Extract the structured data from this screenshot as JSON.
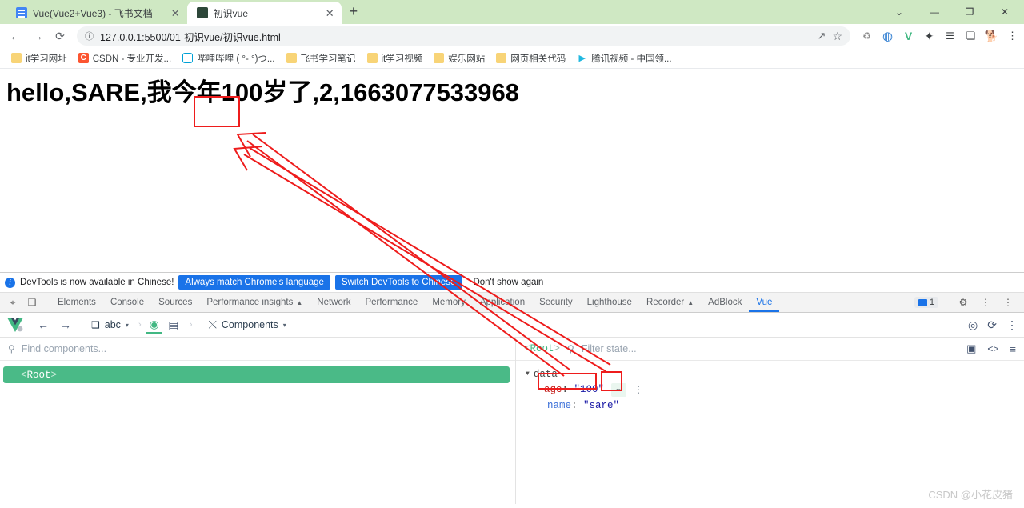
{
  "browser": {
    "tabs": [
      {
        "title": "Vue(Vue2+Vue3) - 飞书文档",
        "favicon": "document-icon",
        "active": false,
        "close_label": "✕"
      },
      {
        "title": "初识vue",
        "favicon": "dark-page-icon",
        "active": true,
        "close_label": "✕"
      }
    ],
    "new_tab_label": "+",
    "window_controls": {
      "expand": "⌄",
      "minimize": "—",
      "maximize": "❐",
      "close": "✕"
    },
    "nav": {
      "back": "←",
      "forward": "→",
      "reload": "⟳"
    },
    "omnibox": {
      "info_icon": "ⓘ",
      "url": "127.0.0.1:5500/01-初识vue/初识vue.html",
      "share_icon": "↗",
      "star_icon": "☆"
    },
    "extensions": [
      {
        "name": "recycle-extension-icon",
        "glyph": "♻"
      },
      {
        "name": "browser-extension-icon",
        "glyph": "◍"
      },
      {
        "name": "vue-devtools-extension-icon",
        "glyph": "V"
      },
      {
        "name": "extensions-puzzle-icon",
        "glyph": "✦"
      },
      {
        "name": "playlist-extension-icon",
        "glyph": "☰"
      },
      {
        "name": "side-panel-icon",
        "glyph": "❏"
      },
      {
        "name": "profile-avatar",
        "glyph": "🐕"
      },
      {
        "name": "chrome-menu-icon",
        "glyph": "⋮"
      }
    ],
    "bookmarks": [
      {
        "label": "it学习网址",
        "icon": "folder-icon"
      },
      {
        "label": "CSDN - 专业开发...",
        "icon": "csdn-icon"
      },
      {
        "label": "哔哩哔哩 ( °- °)つ...",
        "icon": "bilibili-icon"
      },
      {
        "label": "飞书学习笔记",
        "icon": "folder-icon"
      },
      {
        "label": "it学习视频",
        "icon": "folder-icon"
      },
      {
        "label": "娱乐网站",
        "icon": "folder-icon"
      },
      {
        "label": "网页相关代码",
        "icon": "folder-icon"
      },
      {
        "label": "腾讯视频 - 中国领...",
        "icon": "tencent-video-icon"
      }
    ]
  },
  "page": {
    "heading": "hello,SARE,我今年100岁了,2,1663077533968"
  },
  "devtools": {
    "notice": {
      "text": "DevTools is now available in Chinese!",
      "primary_button": "Always match Chrome's language",
      "secondary_button": "Switch DevTools to Chinese",
      "dismiss_button": "Don't show again"
    },
    "inspect_icon": "⌖",
    "device_icon": "❑",
    "tabs": [
      {
        "label": "Elements",
        "active": false
      },
      {
        "label": "Console",
        "active": false
      },
      {
        "label": "Sources",
        "active": false
      },
      {
        "label": "Performance insights",
        "active": false,
        "badge": "▲"
      },
      {
        "label": "Network",
        "active": false
      },
      {
        "label": "Performance",
        "active": false
      },
      {
        "label": "Memory",
        "active": false
      },
      {
        "label": "Application",
        "active": false
      },
      {
        "label": "Security",
        "active": false
      },
      {
        "label": "Lighthouse",
        "active": false
      },
      {
        "label": "Recorder",
        "active": false,
        "badge": "▲"
      },
      {
        "label": "AdBlock",
        "active": false
      },
      {
        "label": "Vue",
        "active": true
      }
    ],
    "message_count": "1",
    "settings_icon": "⚙",
    "more_icon": "⋮",
    "close_icon": "⋮"
  },
  "vue_panel": {
    "toolbar": {
      "logo": "vue-logo",
      "back": "←",
      "forward": "→",
      "app_selector": {
        "icon": "❑",
        "label": "abc",
        "caret": "▾"
      },
      "separator": "›",
      "active_icon": "◉",
      "grid_icon": "▤",
      "separator2": "›",
      "view_selector": {
        "icon": "⤬",
        "label": "Components",
        "caret": "▾"
      },
      "target_icon": "◎",
      "refresh_icon": "⟳",
      "menu_icon": "⋮"
    },
    "components": {
      "search_placeholder": "Find components...",
      "search_icon": "search-icon",
      "tree": [
        {
          "label": "Root",
          "selected": true
        }
      ]
    },
    "state": {
      "root_label": "Root",
      "filter_placeholder": "Filter state...",
      "search_icon": "search-icon",
      "snapshot_icon": "▣",
      "code_icon": "<>",
      "list_icon": "≡",
      "group": "data",
      "entries": [
        {
          "key": "age",
          "value": "\"100\"",
          "highlighted": true,
          "edit_icon": "✏",
          "menu_icon": "⋮"
        },
        {
          "key": "name",
          "value": "\"sare\"",
          "highlighted": false
        }
      ]
    }
  },
  "annotations": {
    "heading_box": "100",
    "value_box": "age: \"100\"",
    "edit_box": "edit-pencil",
    "arrow_color": "#ee1c1c"
  },
  "watermark": "CSDN @小花皮猪"
}
